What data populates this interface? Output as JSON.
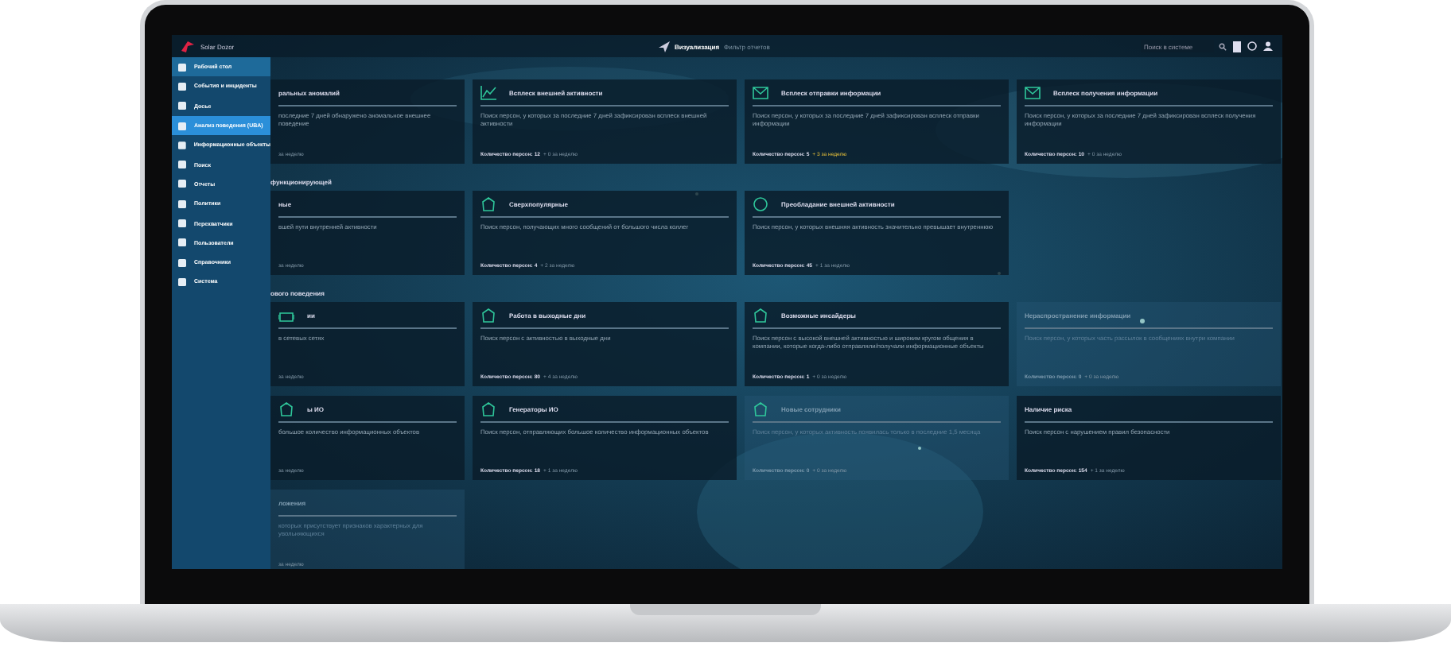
{
  "header": {
    "logo_text": "Solar Dozor",
    "view_title": "Визуализация",
    "view_subtitle": "Фильтр отчетов",
    "search": {
      "placeholder": "Поиск в системе"
    }
  },
  "sidebar": {
    "items": [
      {
        "label": "Рабочий стол",
        "selected": false,
        "hovered": true
      },
      {
        "label": "События и инциденты",
        "selected": false,
        "hovered": false
      },
      {
        "label": "Досье",
        "selected": false,
        "hovered": false
      },
      {
        "label": "Анализ поведения (UBA)",
        "selected": true,
        "hovered": false
      },
      {
        "label": "Информационные объекты",
        "selected": false,
        "hovered": false
      },
      {
        "label": "Поиск",
        "selected": false,
        "hovered": false
      },
      {
        "label": "Отчеты",
        "selected": false,
        "hovered": false
      },
      {
        "label": "Политики",
        "selected": false,
        "hovered": false
      },
      {
        "label": "Перехватчики",
        "selected": false,
        "hovered": false
      },
      {
        "label": "Пользователи",
        "selected": false,
        "hovered": false
      },
      {
        "label": "Справочники",
        "selected": false,
        "hovered": false
      },
      {
        "label": "Система",
        "selected": false,
        "hovered": false
      }
    ]
  },
  "rows": [
    {
      "cards": [
        {
          "title": "ральных аномалий",
          "description": "последние 7 дней обнаружено аномальное внешнее поведение",
          "delta": "за неделю",
          "dimmed": false,
          "highlight": false
        },
        {
          "title": "Всплеск внешней активности",
          "description": "Поиск персон, у которых за последние 7 дней зафиксирован всплеск внешней активности",
          "count": "Количество персон: 12",
          "delta": "+ 0 за неделю",
          "dimmed": false,
          "highlight": false
        },
        {
          "title": "Всплеск отправки информации",
          "description": "Поиск персон, у которых за последние 7 дней зафиксирован всплеск отправки информации",
          "count": "Количество персон: 5",
          "delta": "+ 3 за неделю",
          "dimmed": false,
          "highlight": true
        },
        {
          "title": "Всплеск получения информации",
          "description": "Поиск персон, у которых за последние 7 дней зафиксирован всплеск получения информации",
          "count": "Количество персон: 10",
          "delta": "+ 0 за неделю",
          "dimmed": false,
          "highlight": false
        }
      ]
    },
    {
      "section": "функционирующей",
      "cards": [
        {
          "title": "ные",
          "description": "вшей пути внутренней активности",
          "delta": "за неделю",
          "dimmed": false,
          "highlight": false
        },
        {
          "title": "Сверхпопулярные",
          "description": "Поиск персон, получающих много сообщений от большого числа коллег",
          "count": "Количество персон: 4",
          "delta": "+ 2 за неделю",
          "dimmed": false,
          "highlight": false
        },
        {
          "title": "Преобладание внешней активности",
          "description": "Поиск персон, у которых внешняя активность значительно превышает внутреннюю",
          "count": "Количество персон: 45",
          "delta": "+ 1 за неделю",
          "dimmed": false,
          "highlight": false
        }
      ]
    },
    {
      "section": "ового поведения",
      "cards": [
        {
          "title": "ии",
          "description": "в сетевых сетях",
          "delta": "за неделю",
          "dimmed": false,
          "highlight": false
        },
        {
          "title": "Работа в выходные дни",
          "description": "Поиск персон с активностью в выходные дни",
          "count": "Количество персон: 80",
          "delta": "+ 4 за неделю",
          "dimmed": false,
          "highlight": false
        },
        {
          "title": "Возможные инсайдеры",
          "description": "Поиск персон с высокой внешней активностью и широким кругом общения в компании, которые когда-либо отправляли/получали информационные объекты",
          "count": "Количество персон: 1",
          "delta": "+ 0 за неделю",
          "dimmed": false,
          "highlight": false
        },
        {
          "title": "Нераспространение информации",
          "description": "Поиск персон, у которых часть рассылок в сообщениях внутри компании",
          "count": "Количество персон: 0",
          "delta": "+ 0 за неделю",
          "dimmed": true,
          "highlight": false
        }
      ]
    },
    {
      "cards": [
        {
          "title": "ы ИО",
          "description": "большое количество информационных объектов",
          "delta": "за неделю",
          "dimmed": false,
          "highlight": false
        },
        {
          "title": "Генераторы ИО",
          "description": "Поиск персон, отправляющих большое количество информационных объектов",
          "count": "Количество персон: 18",
          "delta": "+ 1 за неделю",
          "dimmed": false,
          "highlight": false
        },
        {
          "title": "Новые сотрудники",
          "description": "Поиск персон, у которых активность появилась только в последние 1,5 месяца",
          "count": "Количество персон: 0",
          "delta": "+ 0 за неделю",
          "dimmed": true,
          "highlight": false
        },
        {
          "title": "Наличие риска",
          "description": "Поиск персон с нарушением правил безопасности",
          "count": "Количество персон: 154",
          "delta": "+ 1 за неделю",
          "dimmed": false,
          "highlight": false
        }
      ]
    },
    {
      "cards": [
        {
          "title": "ложения",
          "description": "которых присутствует признаков характерных для увольняющихся",
          "delta": "за неделю",
          "dimmed": true,
          "highlight": false
        }
      ]
    }
  ]
}
